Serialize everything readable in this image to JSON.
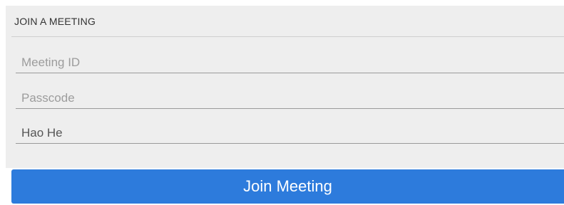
{
  "section": {
    "title": "JOIN A MEETING"
  },
  "fields": {
    "meeting_id": {
      "placeholder": "Meeting ID",
      "value": ""
    },
    "passcode": {
      "placeholder": "Passcode",
      "value": ""
    },
    "name": {
      "placeholder": "",
      "value": "Hao He"
    }
  },
  "join_button": {
    "label": "Join Meeting"
  },
  "colors": {
    "panel_bg": "#eeeeee",
    "button_bg": "#2d7bdc",
    "button_text": "#ffffff"
  }
}
